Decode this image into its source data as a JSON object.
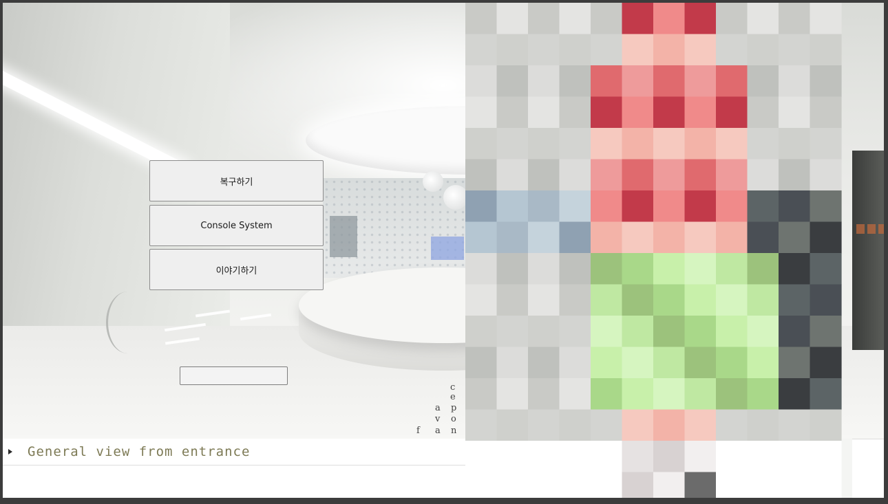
{
  "menu": {
    "restore_label": "복구하기",
    "console_label": "Console System",
    "talk_label": "이야기하기"
  },
  "input": {
    "value": "",
    "placeholder": ""
  },
  "caption": {
    "text": "General view from entrance"
  },
  "wall_letters": [
    "c",
    "e",
    "a",
    "p",
    "v",
    "o",
    "f",
    "a",
    "n"
  ],
  "icons": {
    "caption_expand": "triangle-right-icon"
  },
  "colors": {
    "button_bg": "#efefef",
    "button_border": "#8c8c8c",
    "caption_text": "#7d7a55",
    "frame": "#3c3c3c"
  }
}
